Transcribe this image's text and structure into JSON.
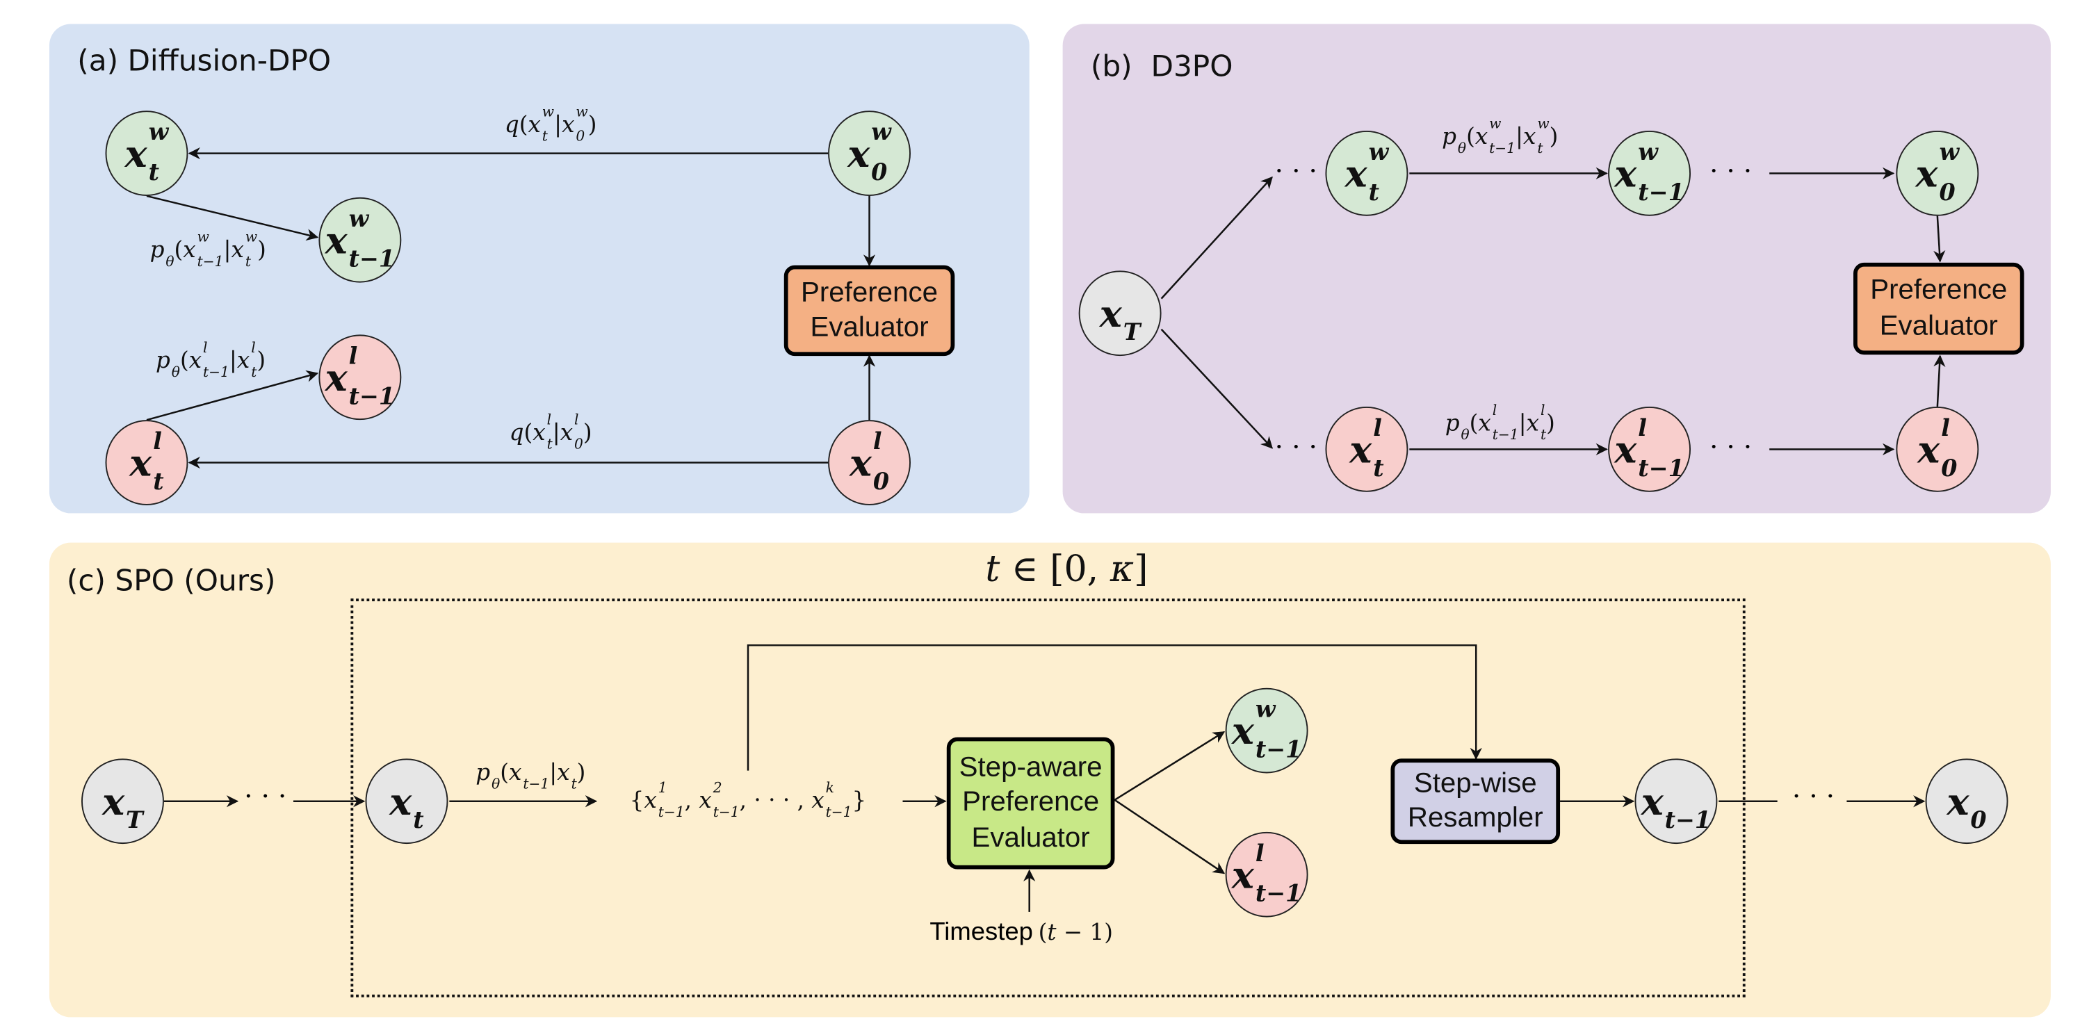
{
  "colors": {
    "panel_a": "#d6e2f3",
    "panel_b": "#e2d6e8",
    "panel_c": "#fdefd0",
    "winner": "#d5e8d4",
    "loser": "#f8cecc",
    "neutral": "#e6e6e6",
    "evaluator": "#f4b084",
    "step_evaluator": "#c8e887",
    "resampler": "#d1d0e6"
  },
  "panel_a": {
    "title": "(a) Diffusion-DPO",
    "nodes": {
      "xt_w": [
        {
          "t": "x",
          "sup": "w",
          "sub": "t"
        }
      ],
      "xt1_w": [
        {
          "t": "x",
          "sup": "w",
          "sub": "t−1"
        }
      ],
      "x0_w": [
        {
          "t": "x",
          "sup": "w",
          "sub": "0"
        }
      ],
      "xt1_l": [
        {
          "t": "x",
          "sup": "l",
          "sub": "t−1"
        }
      ],
      "xt_l": [
        {
          "t": "x",
          "sup": "l",
          "sub": "t"
        }
      ],
      "x0_l": [
        {
          "t": "x",
          "sup": "l",
          "sub": "0"
        }
      ]
    },
    "edge_labels": {
      "q_w": [
        {
          "t": "q"
        },
        {
          "t": "("
        },
        {
          "t": "x",
          "sup": "w",
          "sub": "t"
        },
        {
          "t": "|"
        },
        {
          "t": "x",
          "sup": "w",
          "sub": "0"
        },
        {
          "t": ")"
        }
      ],
      "p_w": [
        {
          "t": "p",
          "sub": "θ"
        },
        {
          "t": "("
        },
        {
          "t": "x",
          "sup": "w",
          "sub": "t−1"
        },
        {
          "t": "|"
        },
        {
          "t": "x",
          "sup": "w",
          "sub": "t"
        },
        {
          "t": ")"
        }
      ],
      "p_l": [
        {
          "t": "p",
          "sub": "θ"
        },
        {
          "t": "("
        },
        {
          "t": "x",
          "sup": "l",
          "sub": "t−1"
        },
        {
          "t": "|"
        },
        {
          "t": "x",
          "sup": "l",
          "sub": "t"
        },
        {
          "t": ")"
        }
      ],
      "q_l": [
        {
          "t": "q"
        },
        {
          "t": "("
        },
        {
          "t": "x",
          "sup": "l",
          "sub": "t"
        },
        {
          "t": "|"
        },
        {
          "t": "x",
          "sup": "l",
          "sub": "0"
        },
        {
          "t": ")"
        }
      ]
    },
    "evaluator": {
      "line1": "Preference",
      "line2": "Evaluator"
    }
  },
  "panel_b": {
    "title": "(b)  D3PO",
    "nodes": {
      "xT": [
        {
          "t": "x",
          "sub": "T"
        }
      ],
      "xt_w": [
        {
          "t": "x",
          "sup": "w",
          "sub": "t"
        }
      ],
      "xt1_w": [
        {
          "t": "x",
          "sup": "w",
          "sub": "t−1"
        }
      ],
      "x0_w": [
        {
          "t": "x",
          "sup": "w",
          "sub": "0"
        }
      ],
      "xt_l": [
        {
          "t": "x",
          "sup": "l",
          "sub": "t"
        }
      ],
      "xt1_l": [
        {
          "t": "x",
          "sup": "l",
          "sub": "t−1"
        }
      ],
      "x0_l": [
        {
          "t": "x",
          "sup": "l",
          "sub": "0"
        }
      ]
    },
    "edge_labels": {
      "p_w": [
        {
          "t": "p",
          "sub": "θ"
        },
        {
          "t": "("
        },
        {
          "t": "x",
          "sup": "w",
          "sub": "t−1"
        },
        {
          "t": "|"
        },
        {
          "t": "x",
          "sup": "w",
          "sub": "t"
        },
        {
          "t": ")"
        }
      ],
      "p_l": [
        {
          "t": "p",
          "sub": "θ"
        },
        {
          "t": "("
        },
        {
          "t": "x",
          "sup": "l",
          "sub": "t−1"
        },
        {
          "t": "|"
        },
        {
          "t": "x",
          "sup": "l",
          "sub": "t"
        },
        {
          "t": ")"
        }
      ]
    },
    "dots": "· · ·",
    "evaluator": {
      "line1": "Preference",
      "line2": "Evaluator"
    }
  },
  "panel_c": {
    "title": "(c) SPO (Ours)",
    "loop_range": [
      {
        "t": "t"
      },
      {
        "t": " ∈ [0, "
      },
      {
        "t": "κ"
      },
      {
        "t": "]"
      }
    ],
    "nodes": {
      "xT": [
        {
          "t": "x",
          "sub": "T"
        }
      ],
      "xt": [
        {
          "t": "x",
          "sub": "t"
        }
      ],
      "xt1_w": [
        {
          "t": "x",
          "sup": "w",
          "sub": "t−1"
        }
      ],
      "xt1_l": [
        {
          "t": "x",
          "sup": "l",
          "sub": "t−1"
        }
      ],
      "xt1": [
        {
          "t": "x",
          "sub": "t−1"
        }
      ],
      "x0": [
        {
          "t": "x",
          "sub": "0"
        }
      ]
    },
    "edge_labels": {
      "p": [
        {
          "t": "p",
          "sub": "θ"
        },
        {
          "t": "("
        },
        {
          "t": "x",
          "sub": "t−1"
        },
        {
          "t": "|"
        },
        {
          "t": "x",
          "sub": "t"
        },
        {
          "t": ")"
        }
      ],
      "samples": [
        {
          "t": "{"
        },
        {
          "t": "x",
          "sup": "1",
          "sub": "t−1"
        },
        {
          "t": ", "
        },
        {
          "t": "x",
          "sup": "2",
          "sub": "t−1"
        },
        {
          "t": ", · · · , "
        },
        {
          "t": "x",
          "sup": "k",
          "sub": "t−1"
        },
        {
          "t": "}"
        }
      ],
      "timestep_math": [
        {
          "t": "("
        },
        {
          "t": "t"
        },
        {
          "t": " − 1)"
        }
      ]
    },
    "timestep_label": "Timestep",
    "dots": "· · ·",
    "step_evaluator": {
      "line1": "Step-aware",
      "line2": "Preference",
      "line3": "Evaluator"
    },
    "resampler": {
      "line1": "Step-wise",
      "line2": "Resampler"
    }
  }
}
